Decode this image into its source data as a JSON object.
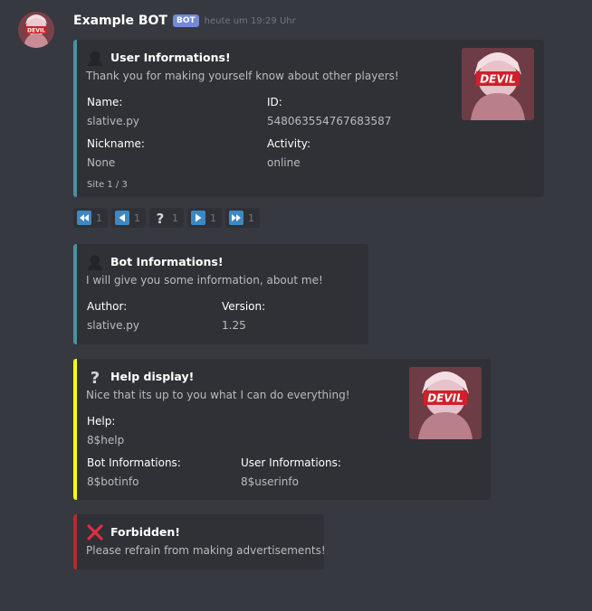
{
  "message": {
    "username": "Example BOT",
    "bot_tag": "BOT",
    "timestamp": "heute um 19:29 Uhr",
    "avatar_text": "DEVIL"
  },
  "colors": {
    "user_embed": "#4f8ea3",
    "bot_embed": "#4f8ea3",
    "help_embed": "#ffff00",
    "forbidden_embed": "#b02e2e"
  },
  "user_embed": {
    "title_icon": "silhouette-icon",
    "title": "User Informations!",
    "description": "Thank you for making yourself know about other players!",
    "fields": [
      {
        "name": "Name:",
        "value": "slative.py"
      },
      {
        "name": "ID:",
        "value": "548063554767683587"
      },
      {
        "name": "Nickname:",
        "value": "None"
      },
      {
        "name": "Activity:",
        "value": "online"
      }
    ],
    "footer": "Site 1 / 3",
    "thumbnail_text": "DEVIL"
  },
  "reactions": [
    {
      "icon": "rewind-icon",
      "count": "1"
    },
    {
      "icon": "arrow-left-icon",
      "count": "1"
    },
    {
      "icon": "question-mark-icon",
      "count": "1"
    },
    {
      "icon": "arrow-right-icon",
      "count": "1"
    },
    {
      "icon": "fast-forward-icon",
      "count": "1"
    }
  ],
  "bot_embed": {
    "title_icon": "silhouette-icon",
    "title": "Bot Informations!",
    "description": "I will give you some information, about me!",
    "fields": [
      {
        "name": "Author:",
        "value": "slative.py"
      },
      {
        "name": "Version:",
        "value": "1.25"
      }
    ]
  },
  "help_embed": {
    "title_icon": "question-mark-icon",
    "title": "Help display!",
    "description": "Nice that its up to you what I can do everything!",
    "fields": [
      {
        "name": "Help:",
        "value": "8$help"
      },
      {
        "name": "Bot Informations:",
        "value": "8$botinfo"
      },
      {
        "name": "User Informations:",
        "value": "8$userinfo"
      }
    ],
    "thumbnail_text": "DEVIL"
  },
  "forbidden_embed": {
    "title_icon": "cross-mark-icon",
    "title": "Forbidden!",
    "description": "Please refrain from making advertisements!"
  }
}
